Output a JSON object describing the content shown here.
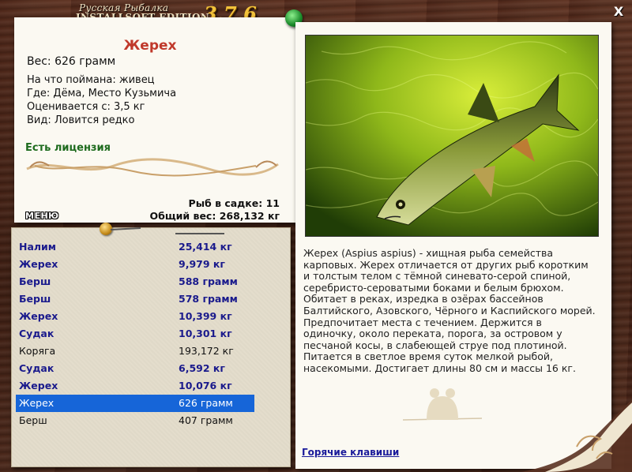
{
  "app": {
    "title_top": "Русская Рыбалка",
    "title_bottom": "INSTALLSOFT EDITION",
    "version": "3.7.6",
    "close_label": "X"
  },
  "catch": {
    "fish_name": "Жерех",
    "weight": "Вес: 626 грамм",
    "bait": "На что поймана: живец",
    "location": "Где: Дёма, Место Кузьмича",
    "rated_from": "Оценивается с: 3,5 кг",
    "type": "Вид: Ловится редко",
    "license": "Есть лицензия"
  },
  "keepnet": {
    "count": "Рыб в садке: 11",
    "total_weight": "Общий вес: 268,132 кг"
  },
  "menu_label": "МЕНЮ",
  "fish_list": [
    {
      "name": "Налим",
      "weight": "25,414 кг",
      "style": "bold"
    },
    {
      "name": "Жерех",
      "weight": "9,979 кг",
      "style": "bold"
    },
    {
      "name": "Берш",
      "weight": "588 грамм",
      "style": "bold"
    },
    {
      "name": "Берш",
      "weight": "578 грамм",
      "style": "bold"
    },
    {
      "name": "Жерех",
      "weight": "10,399 кг",
      "style": "bold"
    },
    {
      "name": "Судак",
      "weight": "10,301 кг",
      "style": "bold"
    },
    {
      "name": "Коряга",
      "weight": "193,172 кг",
      "style": "normal"
    },
    {
      "name": "Судак",
      "weight": "6,592 кг",
      "style": "bold"
    },
    {
      "name": "Жерех",
      "weight": "10,076 кг",
      "style": "bold"
    },
    {
      "name": "Жерех",
      "weight": "626 грамм",
      "style": "selected"
    },
    {
      "name": "Берш",
      "weight": "407 грамм",
      "style": "normal"
    }
  ],
  "description": "Жерех (Aspius aspius) - хищная рыба семейства карповых. Жерех отличается от других рыб коротким и толстым телом с тёмной синевато-серой спиной, серебристо-сероватыми боками и белым брюхом. Обитает в реках, изредка в озёрах бассейнов Балтийского, Азовского, Чёрного и Каспийского морей. Предпочитает места с течением. Держится в одиночку, около переката, порога, за островом у песчаной косы, в слабеющей струе под плотиной. Питается в светлое время суток мелкой рыбой, насекомыми. Достигает длины 80 см и массы 16 кг.",
  "hotkeys_label": "Горячие клавиши",
  "colors": {
    "fish_name": "#c0392b",
    "license": "#1e6b1e",
    "list_bold": "#1a1a8c",
    "selection": "#1665d8",
    "version": "#f2c23a"
  }
}
